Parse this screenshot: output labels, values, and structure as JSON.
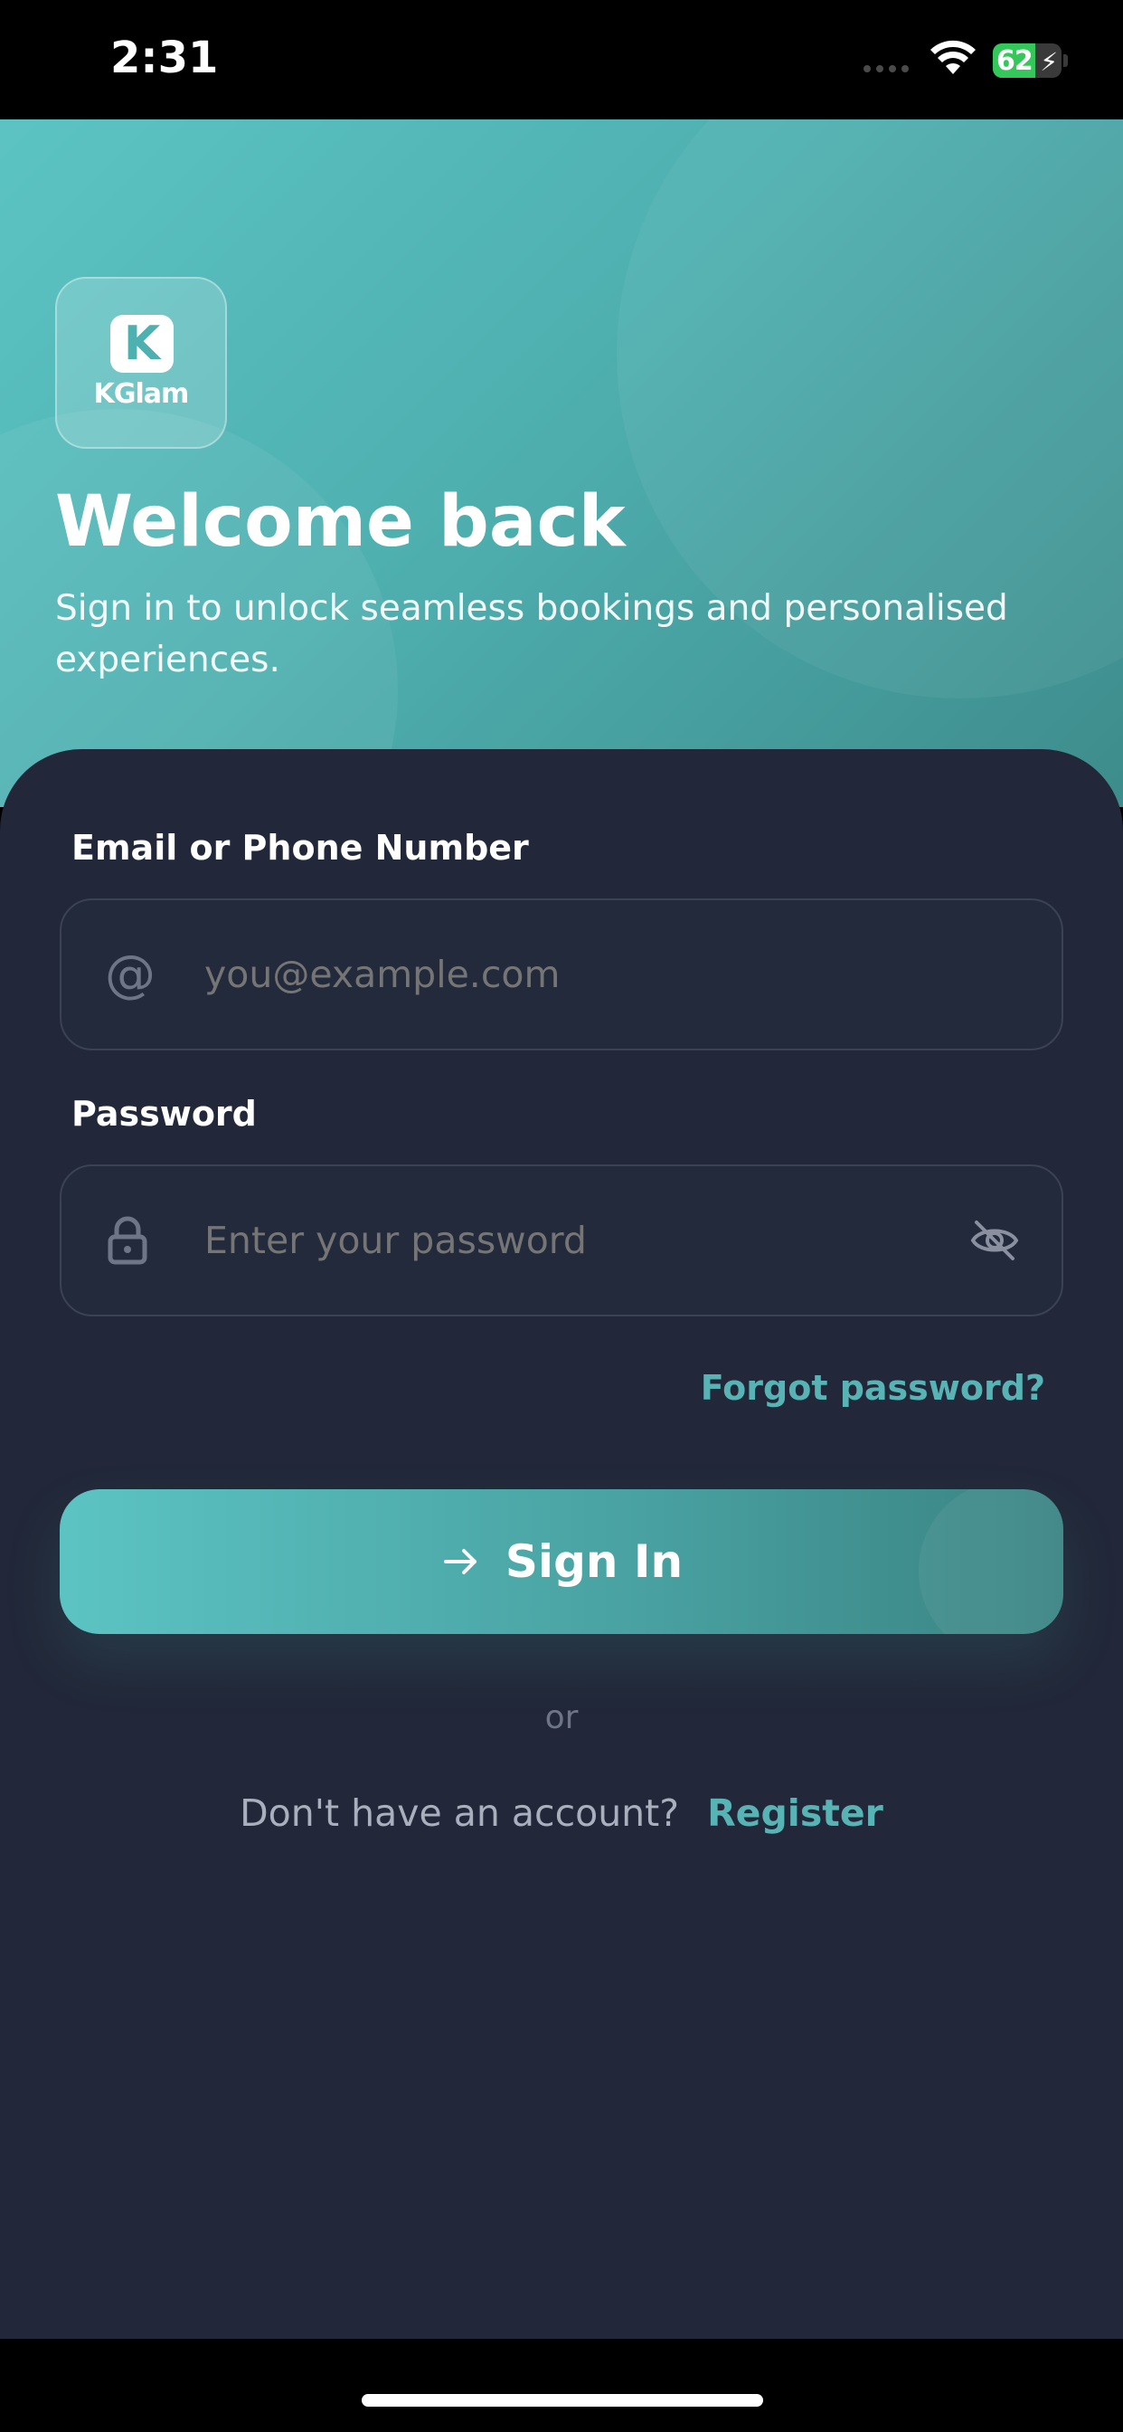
{
  "status_bar": {
    "time": "2:31",
    "battery_percent": "62",
    "battery_level": 0.62,
    "charging": true
  },
  "logo": {
    "letter": "K",
    "name": "KGlam"
  },
  "hero": {
    "title": "Welcome back",
    "subtitle": "Sign in to unlock seamless bookings and personalised experiences."
  },
  "form": {
    "email_label": "Email or Phone Number",
    "email_placeholder": "you@example.com",
    "email_icon": "at-icon",
    "password_label": "Password",
    "password_placeholder": "Enter your password",
    "password_icon": "lock-icon",
    "visibility_icon": "eye-off-icon",
    "forgot_password": "Forgot password?",
    "signin_label": "Sign In",
    "signin_icon": "arrow-right-icon",
    "or_text": "or",
    "register_prompt": "Don't have an account?",
    "register_link": "Register"
  },
  "colors": {
    "accent": "#58b4b4",
    "hero_gradient_start": "#5cc3c3",
    "hero_gradient_end": "#3e8c8c",
    "card_background": "#222839",
    "input_border": "#3b4254"
  }
}
